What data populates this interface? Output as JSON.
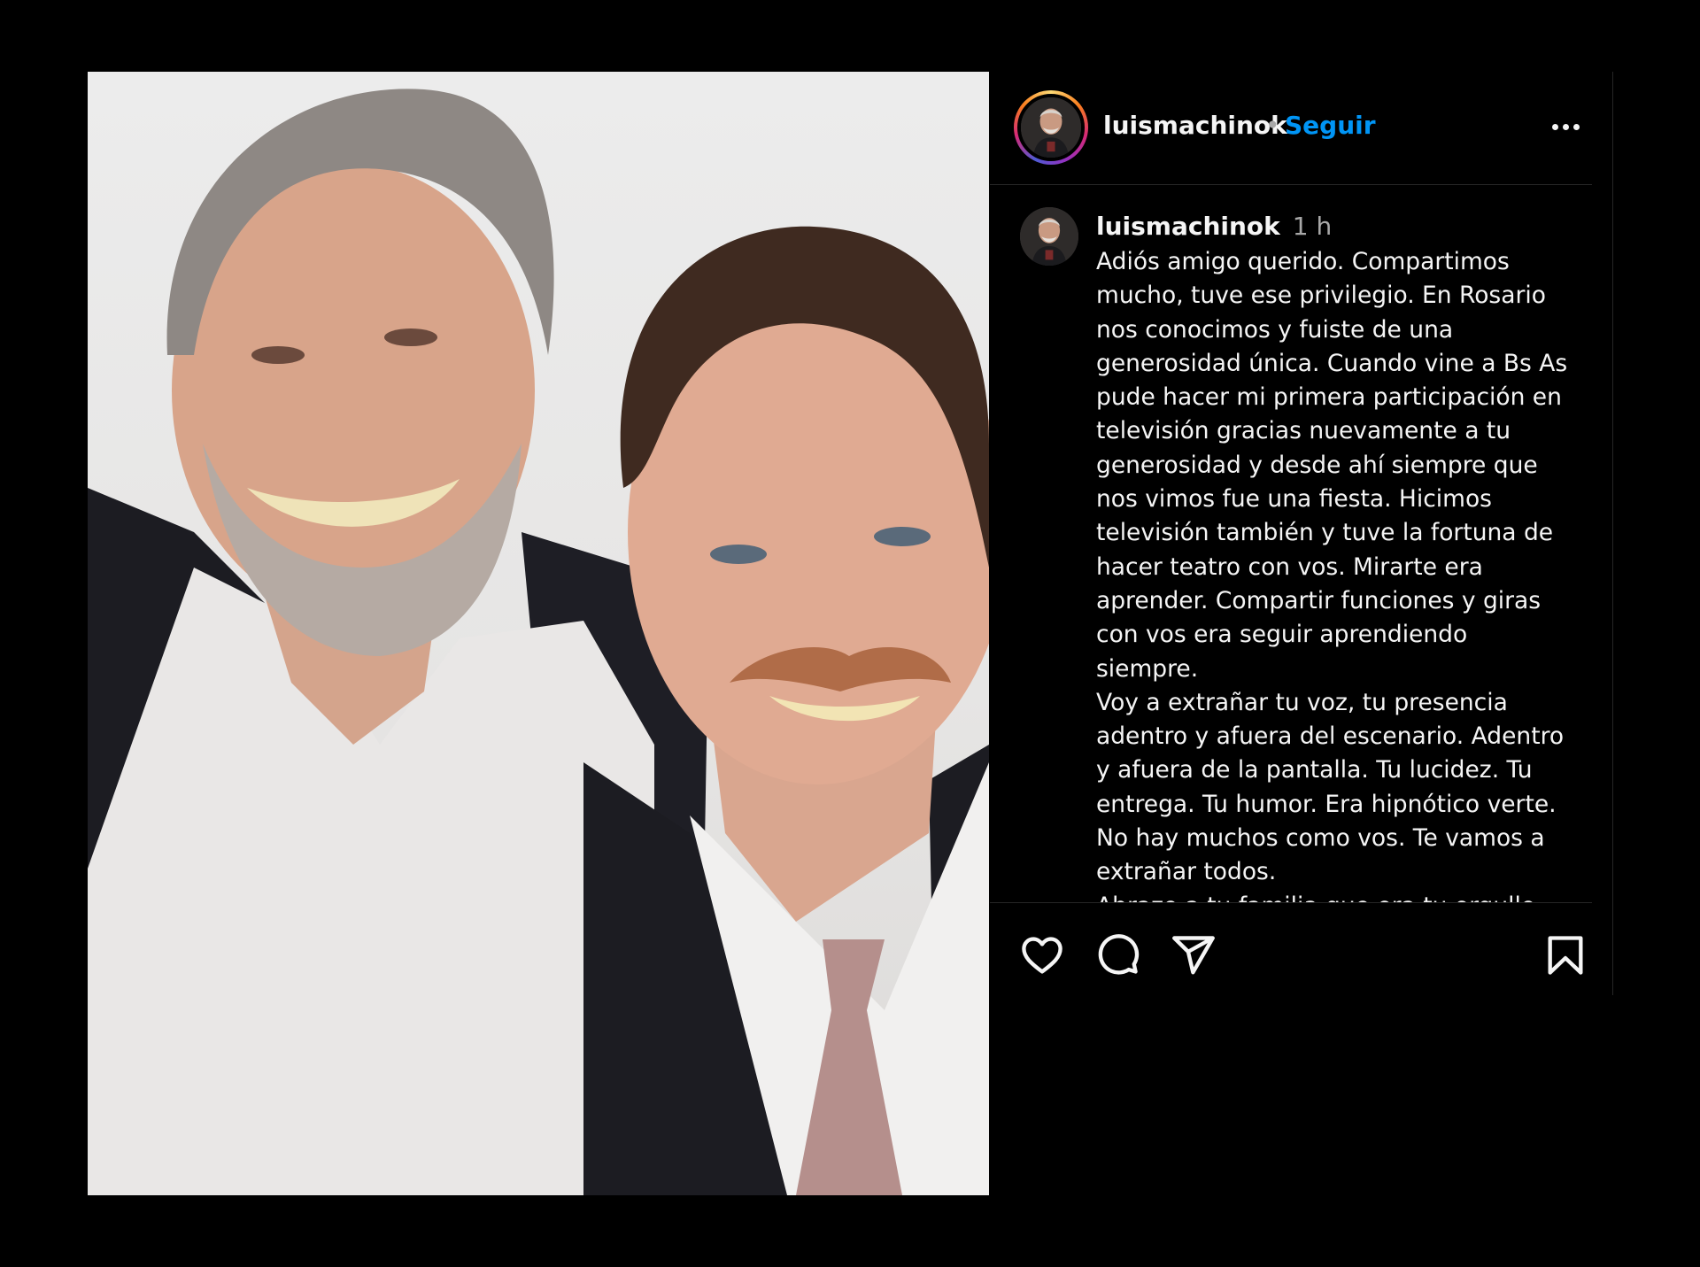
{
  "post": {
    "photo_alt": "two-smiling-men-photo"
  },
  "header": {
    "username": "luismachinok",
    "separator": "•",
    "follow_label": "Seguir",
    "more_icon": "more-horizontal-icon"
  },
  "caption": {
    "username": "luismachinok",
    "time": "1 h",
    "text": "Adiós amigo querido. Compartimos\nmucho, tuve ese privilegio. En Rosario\nnos conocimos y fuiste de una\ngenerosidad única. Cuando vine a Bs As\npude hacer mi primera participación en\ntelevisión gracias nuevamente a tu\ngenerosidad y desde ahí siempre que\nnos vimos fue una fiesta. Hicimos\ntelevisión también y tuve la fortuna de\nhacer teatro con vos. Mirarte era\naprender. Compartir funciones y giras\ncon vos era seguir aprendiendo siempre.\nVoy a extrañar tu voz, tu presencia\nadentro y afuera del escenario. Adentro\ny afuera de la pantalla. Tu lucidez. Tu\nentrega. Tu humor. Era hipnótico verte.\nNo hay muchos como vos. Te vamos a\nextrañar todos.\nAbrazo a tu familia que era tu orgullo.\nLaura, Camila, Manuel. Siempre estaban"
  },
  "actions": {
    "like_icon": "heart-icon",
    "comment_icon": "comment-icon",
    "share_icon": "send-icon",
    "save_icon": "bookmark-icon"
  },
  "colors": {
    "background": "#000000",
    "text": "#f5f5f5",
    "muted": "#a8a8a8",
    "accent": "#0095f6",
    "divider": "#262626"
  }
}
